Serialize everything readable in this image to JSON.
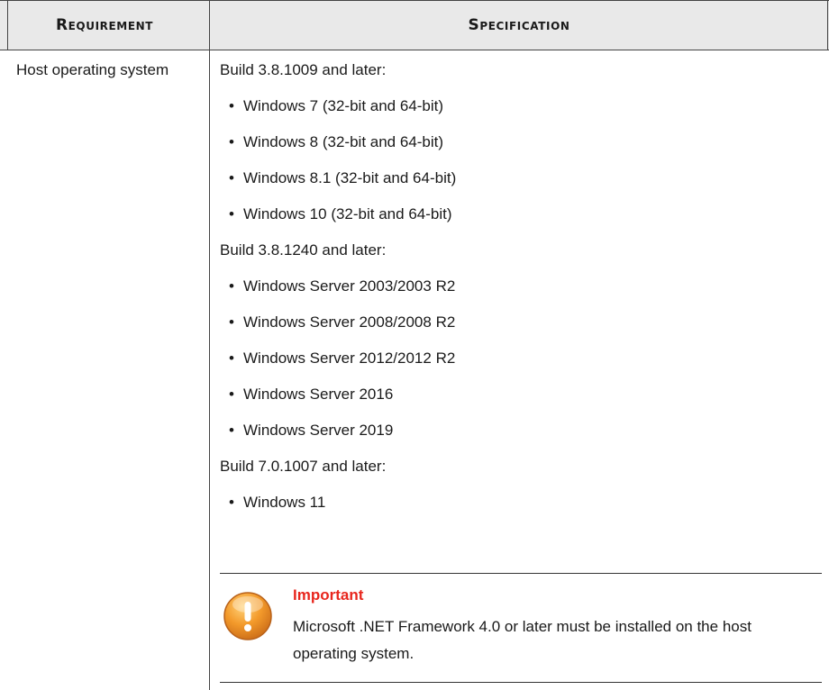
{
  "table": {
    "headers": {
      "requirement": "Requirement",
      "specification": "Specification"
    },
    "row": {
      "requirement": "Host operating system",
      "groups": [
        {
          "build": "Build 3.8.1009 and later:",
          "items": [
            "Windows 7 (32-bit and 64-bit)",
            "Windows 8 (32-bit and 64-bit)",
            "Windows 8.1 (32-bit and 64-bit)",
            "Windows 10 (32-bit and 64-bit)"
          ]
        },
        {
          "build": "Build 3.8.1240 and later:",
          "items": [
            "Windows Server 2003/2003 R2",
            "Windows Server 2008/2008 R2",
            "Windows Server 2012/2012 R2",
            "Windows Server 2016",
            "Windows Server 2019"
          ]
        },
        {
          "build": "Build 7.0.1007 and later:",
          "items": [
            "Windows 11"
          ]
        }
      ],
      "note": {
        "icon": "warning-icon",
        "title": "Important",
        "body": "Microsoft .NET Framework 4.0 or later must be installed on the host operating system."
      }
    }
  },
  "colors": {
    "header_bg": "#e9e9e9",
    "note_title": "#e8261d",
    "icon_orange": "#f39a2b",
    "rule": "#444444"
  }
}
